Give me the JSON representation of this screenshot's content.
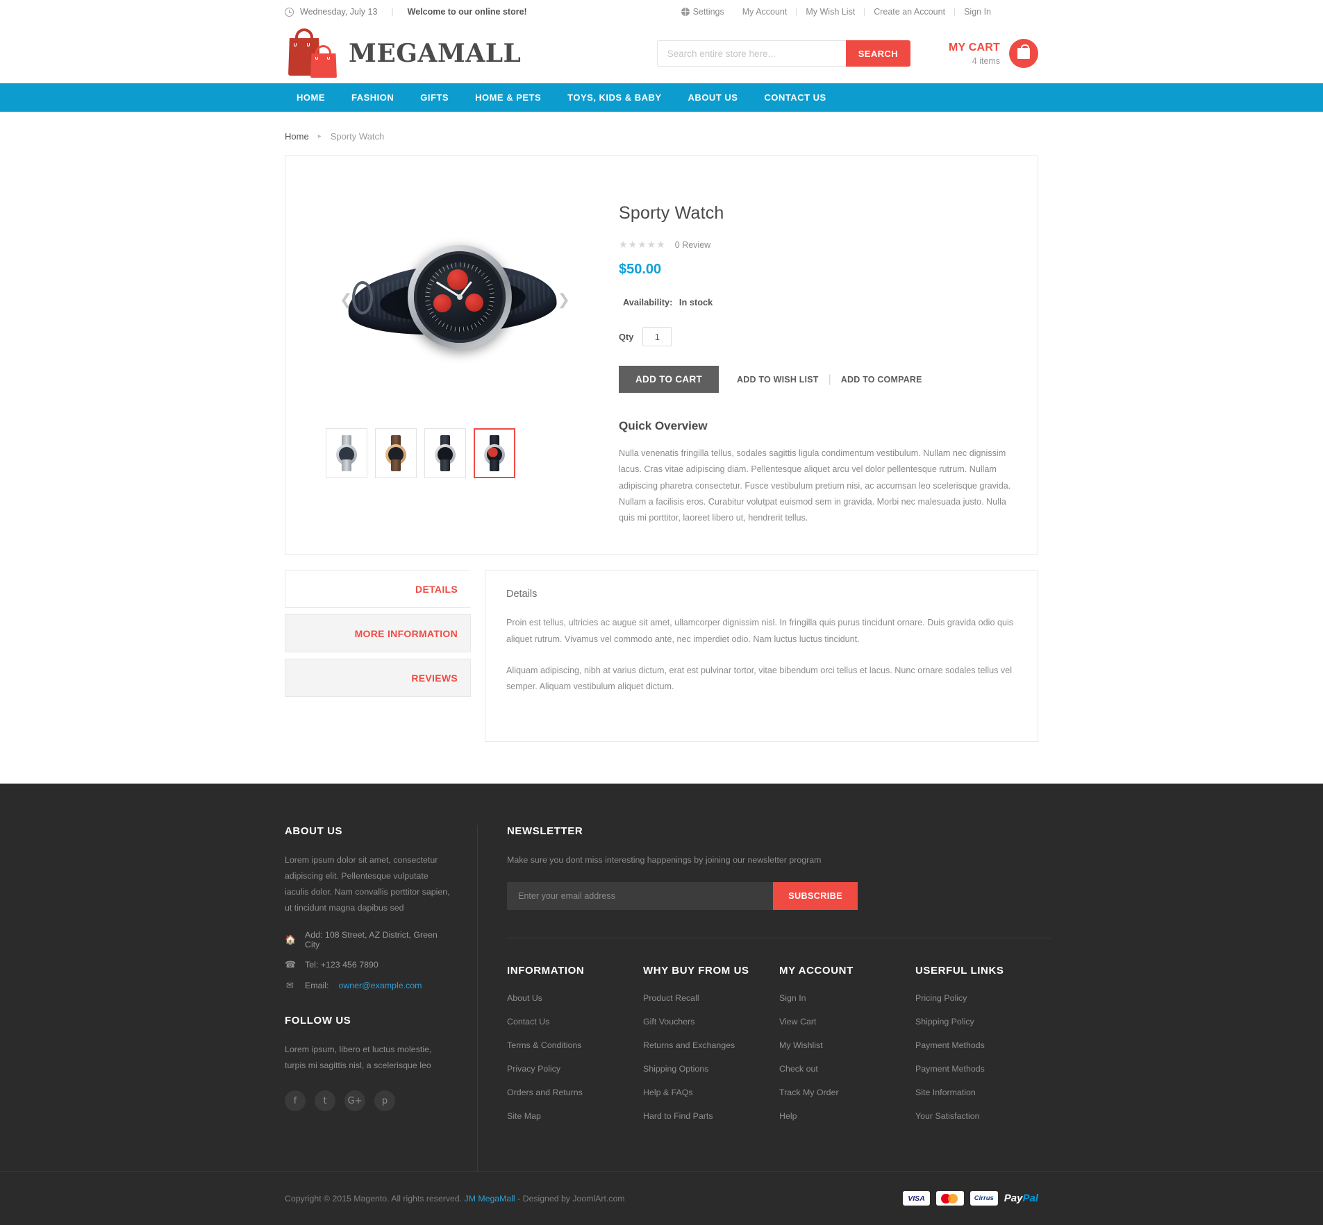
{
  "topbar": {
    "clock_icon": "clock-icon",
    "date": "Wednesday, July 13",
    "welcome": "Welcome to our online store!",
    "settings_icon": "globe-icon",
    "settings": "Settings",
    "my_account": "My Account",
    "my_wish_list": "My Wish List",
    "create_account": "Create an Account",
    "sign_in": "Sign In"
  },
  "header": {
    "logo_text": "MEGAMALL",
    "logo_icon": "shopping-bags-icon",
    "search_placeholder": "Search entire store here...",
    "search_value": "",
    "search_button": "SEARCH",
    "cart_title": "MY CART",
    "cart_items": "4 items",
    "cart_icon": "shopping-bag-icon"
  },
  "nav": {
    "items": [
      {
        "label": "HOME"
      },
      {
        "label": "FASHION"
      },
      {
        "label": "GIFTS"
      },
      {
        "label": "HOME & PETS"
      },
      {
        "label": "TOYS, KIDS & BABY"
      },
      {
        "label": "ABOUT US"
      },
      {
        "label": "CONTACT US"
      }
    ]
  },
  "breadcrumb": {
    "home": "Home",
    "arrow": "▸",
    "current": "Sporty Watch"
  },
  "product": {
    "title": "Sporty Watch",
    "stars": "★★★★★",
    "review_count": "0 Review",
    "price": "$50.00",
    "price_color": "#10a0d8",
    "availability_label": "Availability:",
    "availability_value": "In stock",
    "qty_label": "Qty",
    "qty_value": "1",
    "add_to_cart": "ADD TO CART",
    "add_to_wishlist": "ADD TO WISH LIST",
    "add_to_compare": "ADD TO COMPARE",
    "separator": "|",
    "quick_overview_title": "Quick Overview",
    "quick_overview_text": "Nulla venenatis fringilla tellus, sodales sagittis ligula condimentum vestibulum. Nullam nec dignissim lacus. Cras vitae adipiscing diam. Pellentesque aliquet arcu vel dolor pellentesque rutrum. Nullam adipiscing pharetra consectetur. Fusce vestibulum pretium nisi, ac accumsan leo scelerisque gravida. Nullam a facilisis eros. Curabitur volutpat euismod sem in gravida. Morbi nec malesuada justo. Nulla quis mi porttitor, laoreet libero ut, hendrerit tellus.",
    "gallery_prev_icon": "chevron-left-icon",
    "gallery_next_icon": "chevron-right-icon",
    "thumbnails": [
      {
        "name": "thumbnail-steel-watch",
        "active": false
      },
      {
        "name": "thumbnail-rose-gold-watch",
        "active": false
      },
      {
        "name": "thumbnail-black-watch",
        "active": false
      },
      {
        "name": "thumbnail-sporty-watch",
        "active": true
      }
    ]
  },
  "tabs": {
    "items": [
      {
        "label": "DETAILS",
        "active": true
      },
      {
        "label": "MORE INFORMATION",
        "active": false
      },
      {
        "label": "REVIEWS",
        "active": false
      }
    ],
    "panel_title": "Details",
    "panel_p1": "Proin est tellus, ultricies ac augue sit amet, ullamcorper dignissim nisl. In fringilla quis purus tincidunt ornare. Duis gravida odio quis aliquet rutrum. Vivamus vel commodo ante, nec imperdiet odio. Nam luctus luctus tincidunt.",
    "panel_p2": "Aliquam adipiscing, nibh at varius dictum, erat est pulvinar tortor, vitae bibendum orci tellus et lacus. Nunc ornare sodales tellus vel semper. Aliquam vestibulum aliquet dictum."
  },
  "footer": {
    "about_title": "ABOUT US",
    "about_text": "Lorem ipsum dolor sit amet, consectetur adipiscing elit. Pellentesque vulputate iaculis dolor. Nam convallis porttitor sapien, ut tincidunt magna dapibus sed",
    "address_icon": "home-icon",
    "address": "Add: 108 Street, AZ District, Green City",
    "phone_icon": "phone-icon",
    "phone": "Tel: +123 456 7890",
    "email_icon": "envelope-icon",
    "email_label": "Email:",
    "email": "owner@example.com",
    "follow_title": "FOLLOW US",
    "follow_text": "Lorem ipsum, libero et luctus molestie, turpis mi sagittis nisl, a scelerisque leo",
    "social": [
      {
        "name": "facebook-icon",
        "glyph": "f"
      },
      {
        "name": "twitter-icon",
        "glyph": "t"
      },
      {
        "name": "google-plus-icon",
        "glyph": "G+"
      },
      {
        "name": "pinterest-icon",
        "glyph": "p"
      }
    ],
    "newsletter_title": "NEWSLETTER",
    "newsletter_text": "Make sure you dont miss interesting happenings by joining our newsletter program",
    "newsletter_placeholder": "Enter your email address",
    "newsletter_value": "",
    "subscribe_button": "SUBSCRIBE",
    "columns": [
      {
        "title": "INFORMATION",
        "links": [
          "About Us",
          "Contact Us",
          "Terms & Conditions",
          "Privacy Policy",
          "Orders and Returns",
          "Site Map"
        ]
      },
      {
        "title": "WHY BUY FROM US",
        "links": [
          "Product Recall",
          "Gift Vouchers",
          "Returns and Exchanges",
          "Shipping Options",
          "Help & FAQs",
          "Hard to Find Parts"
        ]
      },
      {
        "title": "MY ACCOUNT",
        "links": [
          "Sign In",
          "View Cart",
          "My Wishlist",
          "Check out",
          "Track My Order",
          "Help"
        ]
      },
      {
        "title": "USERFUL LINKS",
        "links": [
          "Pricing Policy",
          "Shipping Policy",
          "Payment Methods",
          "Payment Methods",
          "Site Information",
          "Your Satisfaction"
        ]
      }
    ],
    "copyright_pre": "Copyright © 2015 Magento. All rights reserved. ",
    "copyright_link": "JM MegaMall",
    "copyright_post": " - Designed by JoomlArt.com",
    "payments": [
      "VISA",
      "MasterCard",
      "Cirrus",
      "PayPal"
    ]
  },
  "colors": {
    "brand_red": "#f04b43",
    "nav_blue": "#0c9dce",
    "price_blue": "#10a0d8",
    "footer_bg": "#2b2b2b"
  }
}
